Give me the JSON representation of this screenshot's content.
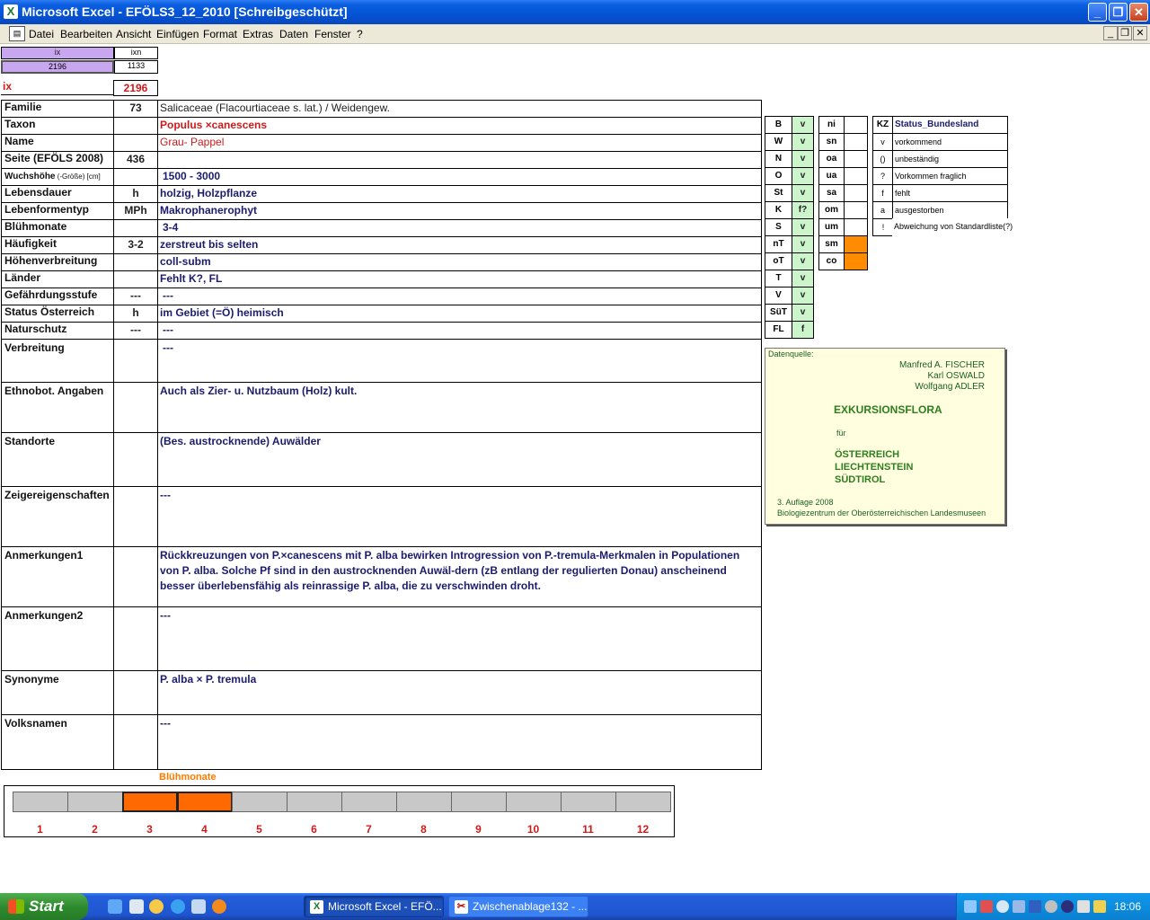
{
  "window": {
    "title": "Microsoft Excel - EFÖLS3_12_2010  [Schreibgeschützt]",
    "app_icon": "X",
    "buttons": {
      "minimize": "_",
      "restore": "❐",
      "close": "✕"
    }
  },
  "menu": {
    "items": [
      "Datei",
      "Bearbeiten",
      "Ansicht",
      "Einfügen",
      "Format",
      "Extras",
      "Daten",
      "Fenster",
      "?"
    ]
  },
  "top_cells": {
    "ix_header": "ix",
    "ixn_header": "ixn",
    "ix_value": "2196",
    "ixn_value": "1133",
    "ix_label": "ix",
    "ix_big": "2196"
  },
  "rows": [
    {
      "label": "Familie",
      "code": "73",
      "value": "Salicaceae (Flacourtiaceae s. lat.)  /  Weidengew."
    },
    {
      "label": "Taxon",
      "code": "",
      "value": "Populus ×canescens"
    },
    {
      "label": "Name",
      "code": "",
      "value": "Grau- Pappel"
    },
    {
      "label": "Seite (EFÖLS 2008)",
      "code": "436",
      "value": ""
    },
    {
      "label_main": "Wuchshöhe",
      "label_sub": " (-Größe) [cm]",
      "code": "",
      "value": "1500 - 3000"
    },
    {
      "label": "Lebensdauer",
      "code": "h",
      "value": "holzig, Holzpflanze"
    },
    {
      "label": "Lebenformentyp",
      "code": "MPh",
      "value": "Makrophanerophyt"
    },
    {
      "label": "Blühmonate",
      "code": "",
      "value": "3-4"
    },
    {
      "label": "Häufigkeit",
      "code": "3-2",
      "value": "zerstreut bis selten"
    },
    {
      "label": "Höhenverbreitung",
      "code": "",
      "value": "coll-subm"
    },
    {
      "label": "Länder",
      "code": "",
      "value": "Fehlt K?, FL"
    },
    {
      "label": "Gefährdungsstufe",
      "code": "---",
      "value": "---"
    },
    {
      "label": "Status Österreich",
      "code": "h",
      "value": "im Gebiet (=Ö) heimisch"
    },
    {
      "label": "Naturschutz",
      "code": "---",
      "value": "---"
    },
    {
      "label": "Verbreitung",
      "code": "",
      "value": "---"
    },
    {
      "label": "Ethnobot. Angaben",
      "code": "",
      "value": "Auch als Zier- u. Nutzbaum (Holz) kult."
    },
    {
      "label": "Standorte",
      "code": "",
      "value": "(Bes. austrocknende) Auwälder"
    },
    {
      "label": "Zeigereigenschaften",
      "code": "",
      "value": "---"
    },
    {
      "label": "Anmerkungen1",
      "code": "",
      "value": "Rückkreuzungen von P.×canescens mit P. alba bewirken Introgression von P.-tremula-Merkmalen in Populationen von P. alba. Solche Pf sind in den austrocknenden Auwäl-dern (zB entlang der regulierten Donau) anscheinend besser überlebensfähig als reinrassige P. alba, die zu verschwinden droht."
    },
    {
      "label": "Anmerkungen2",
      "code": "",
      "value": "---"
    },
    {
      "label": "Synonyme",
      "code": "",
      "value": "P. alba × P. tremula"
    },
    {
      "label": "Volksnamen",
      "code": "",
      "value": "---"
    }
  ],
  "bundesland": [
    {
      "code": "B",
      "val": "v"
    },
    {
      "code": "W",
      "val": "v"
    },
    {
      "code": "N",
      "val": "v"
    },
    {
      "code": "O",
      "val": "v"
    },
    {
      "code": "St",
      "val": "v"
    },
    {
      "code": "K",
      "val": "f?"
    },
    {
      "code": "S",
      "val": "v"
    },
    {
      "code": "nT",
      "val": "v"
    },
    {
      "code": "oT",
      "val": "v"
    },
    {
      "code": "T",
      "val": "v"
    },
    {
      "code": "V",
      "val": "v"
    },
    {
      "code": "SüT",
      "val": "v"
    },
    {
      "code": "FL",
      "val": "f"
    }
  ],
  "hoehenstufen": [
    {
      "code": "ni",
      "on": false
    },
    {
      "code": "sn",
      "on": false
    },
    {
      "code": "oa",
      "on": false
    },
    {
      "code": "ua",
      "on": false
    },
    {
      "code": "sa",
      "on": false
    },
    {
      "code": "om",
      "on": false
    },
    {
      "code": "um",
      "on": false
    },
    {
      "code": "sm",
      "on": true
    },
    {
      "code": "co",
      "on": true
    }
  ],
  "status_legend": {
    "header_kz": "KZ",
    "header_label": "Status_Bundesland",
    "items": [
      {
        "kz": "v",
        "text": "vorkommend"
      },
      {
        "kz": "()",
        "text": "unbeständig"
      },
      {
        "kz": "?",
        "text": "Vorkommen fraglich"
      },
      {
        "kz": "f",
        "text": "fehlt"
      },
      {
        "kz": "a",
        "text": "ausgestorben"
      },
      {
        "kz": "!",
        "text": "Abweichung von Standardliste(?)"
      }
    ]
  },
  "datenquelle": {
    "label": "Datenquelle:",
    "authors": [
      "Manfred A. FISCHER",
      "Karl OSWALD",
      "Wolfgang ADLER"
    ],
    "title": "EXKURSIONSFLORA",
    "fuer": "für",
    "regions": [
      "ÖSTERREICH",
      "LIECHTENSTEIN",
      "SÜDTIROL"
    ],
    "edition": "3. Auflage 2008",
    "publisher": "Biologiezentrum der Oberösterreichischen Landesmuseen"
  },
  "bluehmonate_chart": {
    "title": "Blühmonate",
    "months": [
      "1",
      "2",
      "3",
      "4",
      "5",
      "6",
      "7",
      "8",
      "9",
      "10",
      "11",
      "12"
    ],
    "flowering": [
      false,
      false,
      true,
      true,
      false,
      false,
      false,
      false,
      false,
      false,
      false,
      false
    ],
    "color_on": "#ff6a00",
    "color_off": "#c8c8c8"
  },
  "taskbar": {
    "start": "Start",
    "tasks": [
      {
        "icon": "X",
        "label": "Microsoft Excel - EFÖ..."
      },
      {
        "icon": "✂",
        "label": "Zwischenablage132 - ..."
      }
    ],
    "clock": "18:06"
  }
}
